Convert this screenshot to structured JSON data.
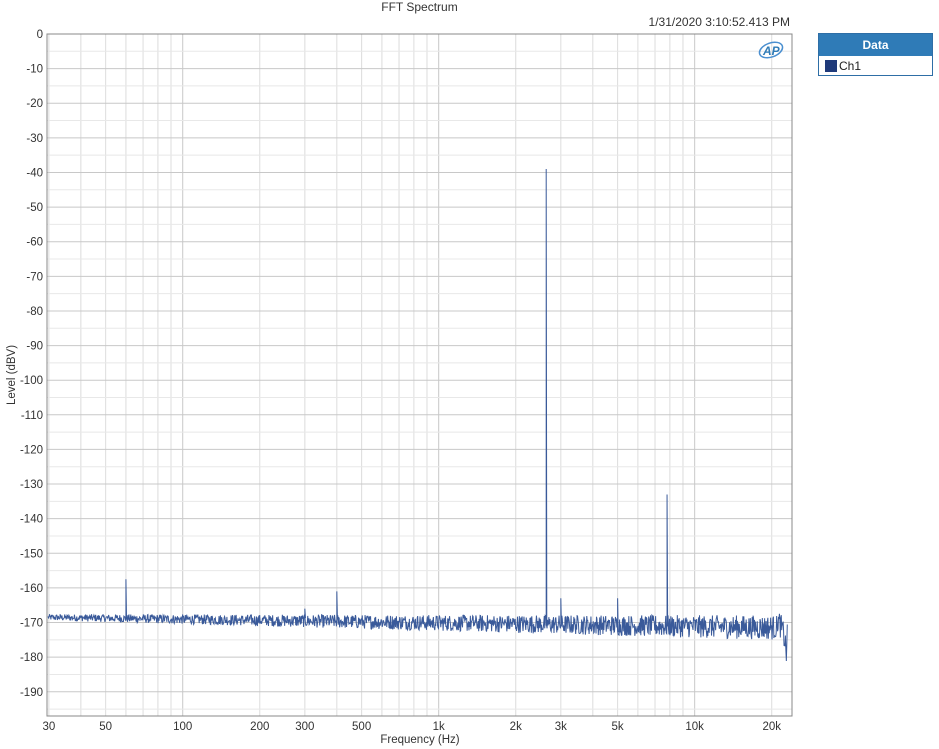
{
  "header": {
    "title": "FFT Spectrum",
    "timestamp": "1/31/2020 3:10:52.413 PM"
  },
  "legend": {
    "header": "Data",
    "items": [
      {
        "label": "Ch1",
        "color": "#1f3a7a"
      }
    ]
  },
  "colors": {
    "trace": "#3a5a9a",
    "legend_header": "#2f7bb7",
    "grid": "#dcdcdc"
  },
  "chart_data": {
    "type": "line",
    "title": "FFT Spectrum",
    "xlabel": "Frequency (Hz)",
    "ylabel": "Level (dBV)",
    "x_scale": "log",
    "xlim": [
      29.5,
      24000
    ],
    "ylim": [
      -197,
      0
    ],
    "x_ticks": [
      {
        "v": 30,
        "label": "30"
      },
      {
        "v": 50,
        "label": "50"
      },
      {
        "v": 100,
        "label": "100"
      },
      {
        "v": 200,
        "label": "200"
      },
      {
        "v": 300,
        "label": "300"
      },
      {
        "v": 500,
        "label": "500"
      },
      {
        "v": 1000,
        "label": "1k"
      },
      {
        "v": 2000,
        "label": "2k"
      },
      {
        "v": 3000,
        "label": "3k"
      },
      {
        "v": 5000,
        "label": "5k"
      },
      {
        "v": 10000,
        "label": "10k"
      },
      {
        "v": 20000,
        "label": "20k"
      }
    ],
    "y_ticks": [
      0,
      -10,
      -20,
      -30,
      -40,
      -50,
      -60,
      -70,
      -80,
      -90,
      -100,
      -110,
      -120,
      -130,
      -140,
      -150,
      -160,
      -170,
      -180,
      -190
    ],
    "grid": true,
    "legend_position": "outside-top-right",
    "series": [
      {
        "name": "Ch1",
        "noise_floor": {
          "start_db": -168.5,
          "end_db": -171.5,
          "fluctuation_db": 3
        },
        "rolloff": [
          [
            21000,
            -169
          ],
          [
            22000,
            -172
          ],
          [
            22500,
            -175
          ],
          [
            23000,
            -181
          ]
        ],
        "peaks": [
          {
            "x": 60,
            "y": -157.5
          },
          {
            "x": 300,
            "y": -166
          },
          {
            "x": 400,
            "y": -161
          },
          {
            "x": 2630,
            "y": -39
          },
          {
            "x": 3000,
            "y": -163
          },
          {
            "x": 5000,
            "y": -163
          },
          {
            "x": 7800,
            "y": -133
          }
        ]
      }
    ]
  }
}
